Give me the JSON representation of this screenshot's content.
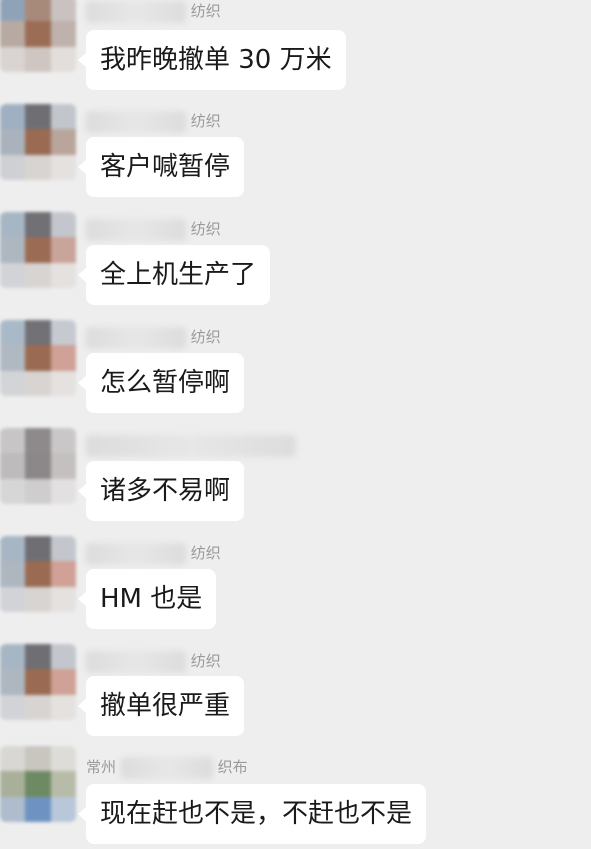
{
  "messages": [
    {
      "sender": "纺织",
      "text": "我昨晚撤单 30 万米"
    },
    {
      "sender": "纺织",
      "text": "客户喊暂停"
    },
    {
      "sender": "纺织",
      "text": "全上机生产了"
    },
    {
      "sender": "纺织",
      "text": "怎么暂停啊"
    },
    {
      "sender": "",
      "text": "诸多不易啊"
    },
    {
      "sender": "纺织",
      "text": "HM 也是"
    },
    {
      "sender": "纺织",
      "text": "撤单很严重"
    },
    {
      "sender_prefix": "常州",
      "sender": "织布",
      "text": "现在赶也不是，不赶也不是"
    }
  ],
  "colors": {
    "background": "#eeeeee",
    "bubble": "#ffffff",
    "text": "#1a1a1a",
    "name": "#9a9a9a"
  }
}
